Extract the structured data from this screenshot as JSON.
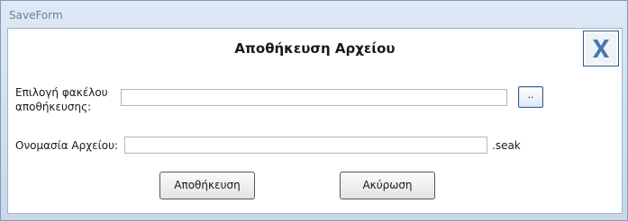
{
  "window": {
    "title": "SaveForm"
  },
  "dialog": {
    "heading": "Αποθήκευση Αρχείου",
    "folder_label_line1": "Επιλογή φακέλου",
    "folder_label_line2": "αποθήκευσης:",
    "folder_value": "",
    "browse_label": "..",
    "filename_label": "Ονομασία Αρχείου:",
    "filename_value": "",
    "extension": ".seak",
    "save_label": "Αποθήκευση",
    "cancel_label": "Ακύρωση"
  },
  "icons": {
    "close": "close-x-icon"
  },
  "colors": {
    "close_x": "#4a78ad",
    "frame": "#c9d7e8"
  }
}
